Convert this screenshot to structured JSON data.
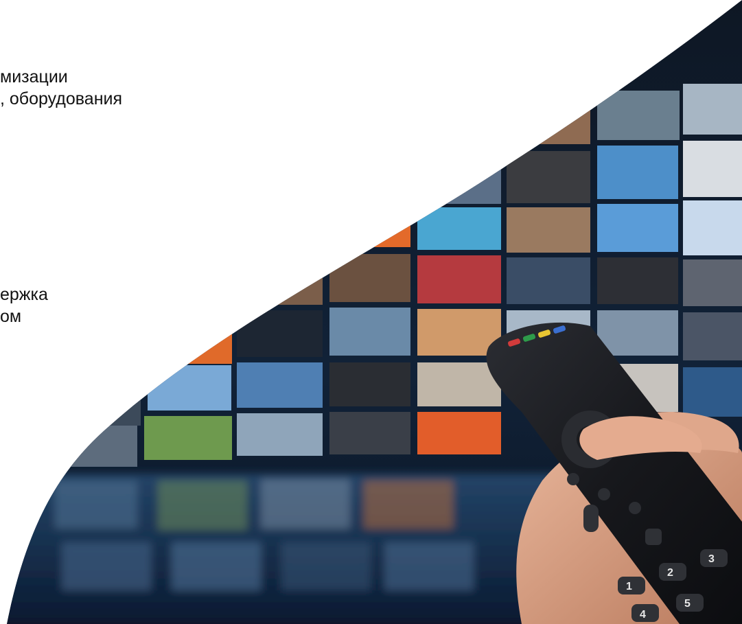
{
  "text_top": {
    "line1": "мизации",
    "line2": ", оборудования"
  },
  "text_middle": {
    "line1": "ержка",
    "line2": "ом"
  },
  "photo": {
    "description_icon": "tv-wall-remote-photo",
    "remote_buttons": [
      "1",
      "2",
      "3",
      "4",
      "5"
    ],
    "colors": {
      "background": "#ffffff",
      "wall_dark": "#0d1a2b",
      "screen_glow": "#3a6fa8",
      "remote": "#1c1d21",
      "skin": "#d8a084"
    }
  }
}
